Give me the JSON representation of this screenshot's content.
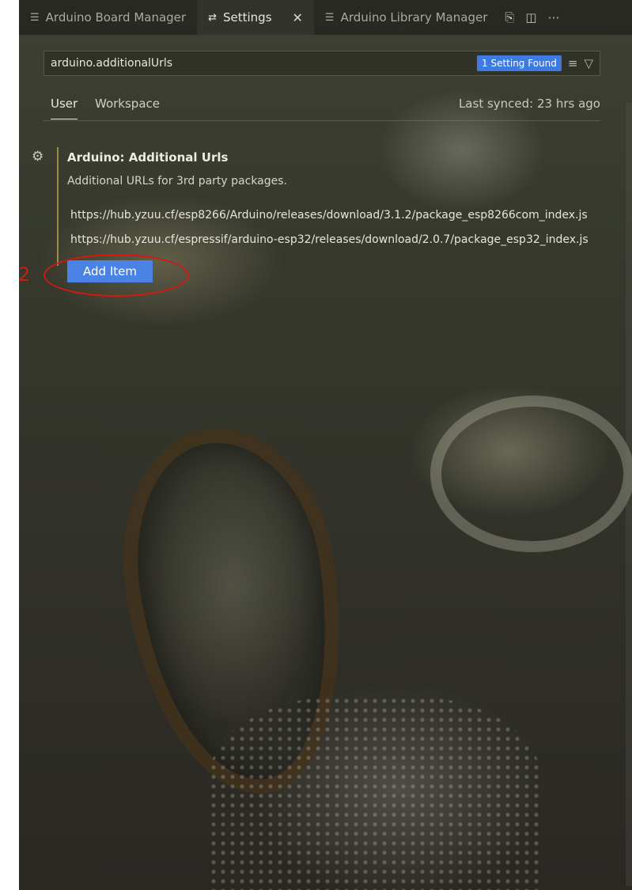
{
  "tabs": [
    {
      "label": "Arduino Board Manager",
      "icon": "list-icon"
    },
    {
      "label": "Settings",
      "icon": "settings-sliders-icon",
      "active": true
    },
    {
      "label": "Arduino Library Manager",
      "icon": "list-icon"
    }
  ],
  "tab_close": "✕",
  "search": {
    "value": "arduino.additionalUrls",
    "found_badge": "1 Setting Found"
  },
  "scopes": {
    "user": "User",
    "workspace": "Workspace",
    "last_synced": "Last synced: 23 hrs ago"
  },
  "setting": {
    "title": "Arduino: Additional Urls",
    "description": "Additional URLs for 3rd party packages.",
    "urls": [
      "https://hub.yzuu.cf/esp8266/Arduino/releases/download/3.1.2/package_esp8266com_index.js",
      "https://hub.yzuu.cf/espressif/arduino-esp32/releases/download/2.0.7/package_esp32_index.js"
    ],
    "add_button": "Add Item"
  },
  "annotation": {
    "number": "2",
    "color": "#d31a12"
  },
  "colors": {
    "accent": "#4b82e6",
    "badge": "#3d7be0",
    "modified_bar": "#bea550"
  }
}
